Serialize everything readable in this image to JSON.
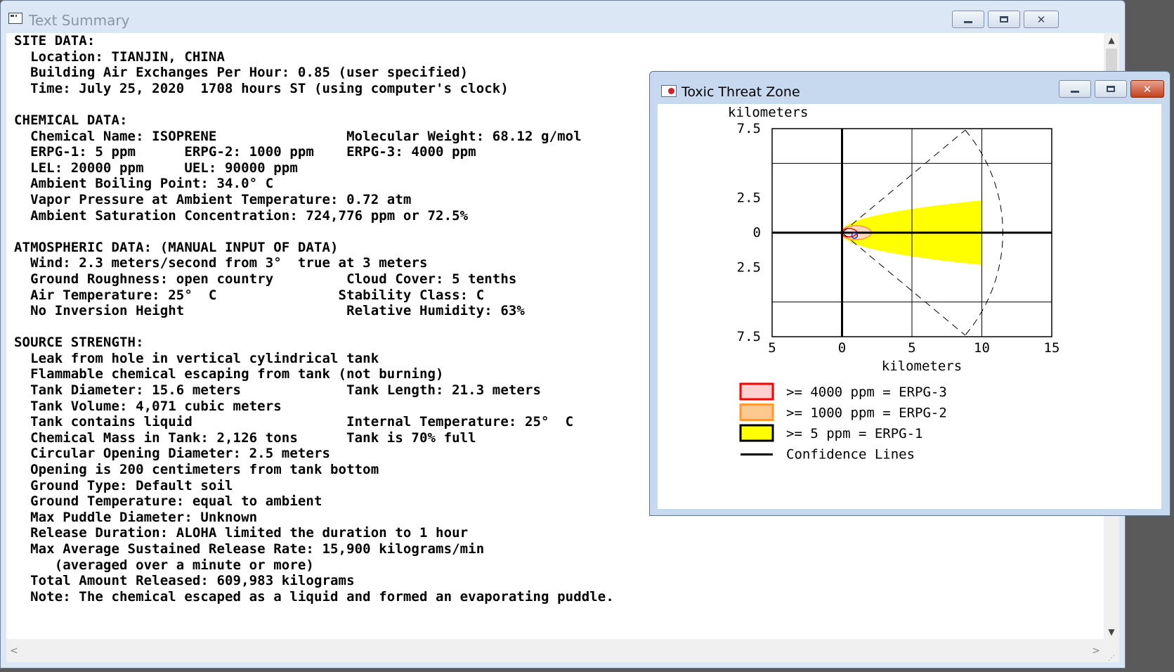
{
  "main_window": {
    "title": "Text Summary",
    "lines": [
      "SITE DATA:",
      "  Location: TIANJIN, CHINA",
      "  Building Air Exchanges Per Hour: 0.85 (user specified)",
      "  Time: July 25, 2020  1708 hours ST (using computer's clock)",
      "",
      "CHEMICAL DATA:",
      "  Chemical Name: ISOPRENE                Molecular Weight: 68.12 g/mol",
      "  ERPG-1: 5 ppm      ERPG-2: 1000 ppm    ERPG-3: 4000 ppm",
      "  LEL: 20000 ppm     UEL: 90000 ppm",
      "  Ambient Boiling Point: 34.0° C",
      "  Vapor Pressure at Ambient Temperature: 0.72 atm",
      "  Ambient Saturation Concentration: 724,776 ppm or 72.5%",
      "",
      "ATMOSPHERIC DATA: (MANUAL INPUT OF DATA)",
      "  Wind: 2.3 meters/second from 3°  true at 3 meters",
      "  Ground Roughness: open country         Cloud Cover: 5 tenths",
      "  Air Temperature: 25°  C               Stability Class: C",
      "  No Inversion Height                    Relative Humidity: 63%",
      "",
      "SOURCE STRENGTH:",
      "  Leak from hole in vertical cylindrical tank",
      "  Flammable chemical escaping from tank (not burning)",
      "  Tank Diameter: 15.6 meters             Tank Length: 21.3 meters",
      "  Tank Volume: 4,071 cubic meters",
      "  Tank contains liquid                   Internal Temperature: 25°  C",
      "  Chemical Mass in Tank: 2,126 tons      Tank is 70% full",
      "  Circular Opening Diameter: 2.5 meters",
      "  Opening is 200 centimeters from tank bottom",
      "  Ground Type: Default soil",
      "  Ground Temperature: equal to ambient",
      "  Max Puddle Diameter: Unknown",
      "  Release Duration: ALOHA limited the duration to 1 hour",
      "  Max Average Sustained Release Rate: 15,900 kilograms/min",
      "     (averaged over a minute or more)",
      "  Total Amount Released: 609,983 kilograms",
      "  Note: The chemical escaped as a liquid and formed an evaporating puddle."
    ]
  },
  "toxic_window": {
    "title": "Toxic Threat Zone"
  },
  "icons": {
    "up_arrow": "▲",
    "down_arrow": "▼",
    "left_arrow": "<",
    "right_arrow": ">",
    "minimize": "minimize-icon",
    "maximize": "maximize-icon",
    "close": "✕"
  },
  "colors": {
    "erpg3": "#ff0000",
    "erpg2": "#ff9933",
    "erpg1": "#ffff00",
    "confidence": "#000000"
  },
  "chart_data": {
    "type": "area",
    "xlabel": "kilometers",
    "ylabel": "kilometers",
    "x_ticks": [
      "5",
      "0",
      "5",
      "10",
      "15"
    ],
    "y_ticks": [
      "7.5",
      "2.5",
      "0",
      "2.5",
      "7.5"
    ],
    "xlim": [
      -5,
      15
    ],
    "ylim": [
      -7.5,
      7.5
    ],
    "grid": true,
    "legend": [
      {
        "label": ">= 4000 ppm = ERPG-3",
        "color": "#ff0000"
      },
      {
        "label": ">= 1000 ppm = ERPG-2",
        "color": "#ff9933"
      },
      {
        "label": ">= 5 ppm = ERPG-1",
        "color": "#ffff00"
      },
      {
        "label": "Confidence Lines",
        "color": "#000000"
      }
    ],
    "zones": [
      {
        "name": "ERPG-1",
        "max_downwind_km": 10,
        "max_halfwidth_km": 2.3
      },
      {
        "name": "ERPG-2",
        "max_downwind_km": 2.0,
        "max_halfwidth_km": 0.4
      },
      {
        "name": "ERPG-3",
        "max_downwind_km": 1.0,
        "max_halfwidth_km": 0.3
      }
    ]
  }
}
